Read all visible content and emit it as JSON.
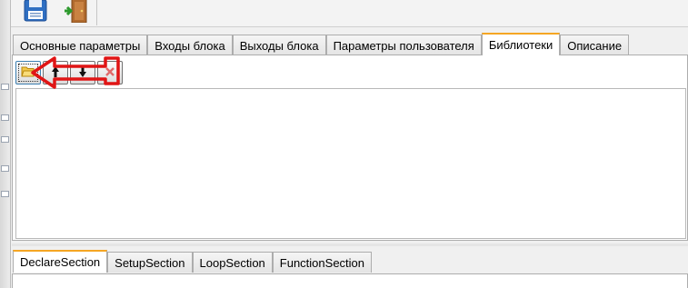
{
  "toolbar": {
    "buttons": [
      {
        "icon": "save-icon"
      },
      {
        "icon": "exit-door-icon"
      }
    ]
  },
  "top_tabs": [
    {
      "label": "Основные параметры",
      "active": false
    },
    {
      "label": "Входы блока",
      "active": false
    },
    {
      "label": "Выходы блока",
      "active": false
    },
    {
      "label": "Параметры пользователя",
      "active": false
    },
    {
      "label": "Библиотеки",
      "active": true
    },
    {
      "label": "Описание",
      "active": false
    }
  ],
  "library_toolbar": {
    "buttons": [
      {
        "icon": "open-folder-icon"
      },
      {
        "icon": "move-up-arrow-icon"
      },
      {
        "icon": "move-down-arrow-icon"
      },
      {
        "icon": "delete-x-icon"
      }
    ]
  },
  "bottom_tabs": [
    {
      "label": "DeclareSection",
      "active": true
    },
    {
      "label": "SetupSection",
      "active": false
    },
    {
      "label": "LoopSection",
      "active": false
    },
    {
      "label": "FunctionSection",
      "active": false
    }
  ],
  "colors": {
    "active_tab_accent": "#f5a623",
    "annotation_red": "#e01515",
    "panel_border": "#adadad"
  }
}
